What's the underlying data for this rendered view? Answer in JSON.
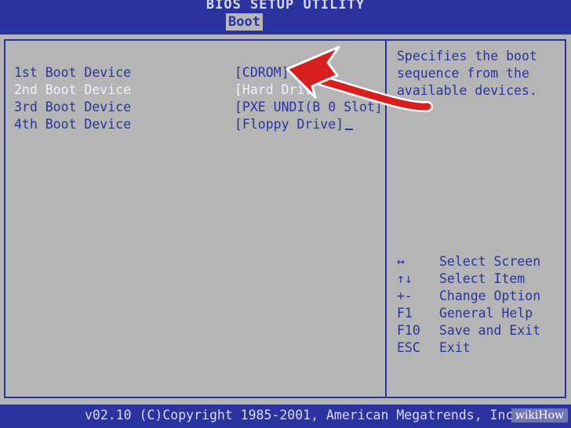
{
  "header": {
    "title": "BIOS SETUP UTILITY",
    "active_tab": "Boot"
  },
  "boot_devices": [
    {
      "label": "1st Boot Device",
      "value": "[CDROM]",
      "selected": false
    },
    {
      "label": "2nd Boot Device",
      "value": "[Hard Driv",
      "selected": true
    },
    {
      "label": "3rd Boot Device",
      "value": "[PXE UNDI(B 0 Slot]",
      "selected": false
    },
    {
      "label": "4th Boot Device",
      "value": "[Floppy Drive]",
      "selected": false
    }
  ],
  "help_text": "Specifies the boot\nsequence from the\navailable devices.",
  "key_legend": [
    {
      "key": "↔",
      "desc": "Select Screen"
    },
    {
      "key": "↑↓",
      "desc": "Select Item"
    },
    {
      "key": "+-",
      "desc": "Change Option"
    },
    {
      "key": "F1",
      "desc": "General Help"
    },
    {
      "key": "F10",
      "desc": "Save and Exit"
    },
    {
      "key": "ESC",
      "desc": "Exit"
    }
  ],
  "footer": {
    "copyright": "v02.10 (C)Copyright 1985-2001, American Megatrends, Inc.",
    "watermark": "wikiHow"
  },
  "colors": {
    "bios_blue": "#2a33a0",
    "panel_gray": "#b5b5b5",
    "arrow_red": "#d91e1e"
  }
}
